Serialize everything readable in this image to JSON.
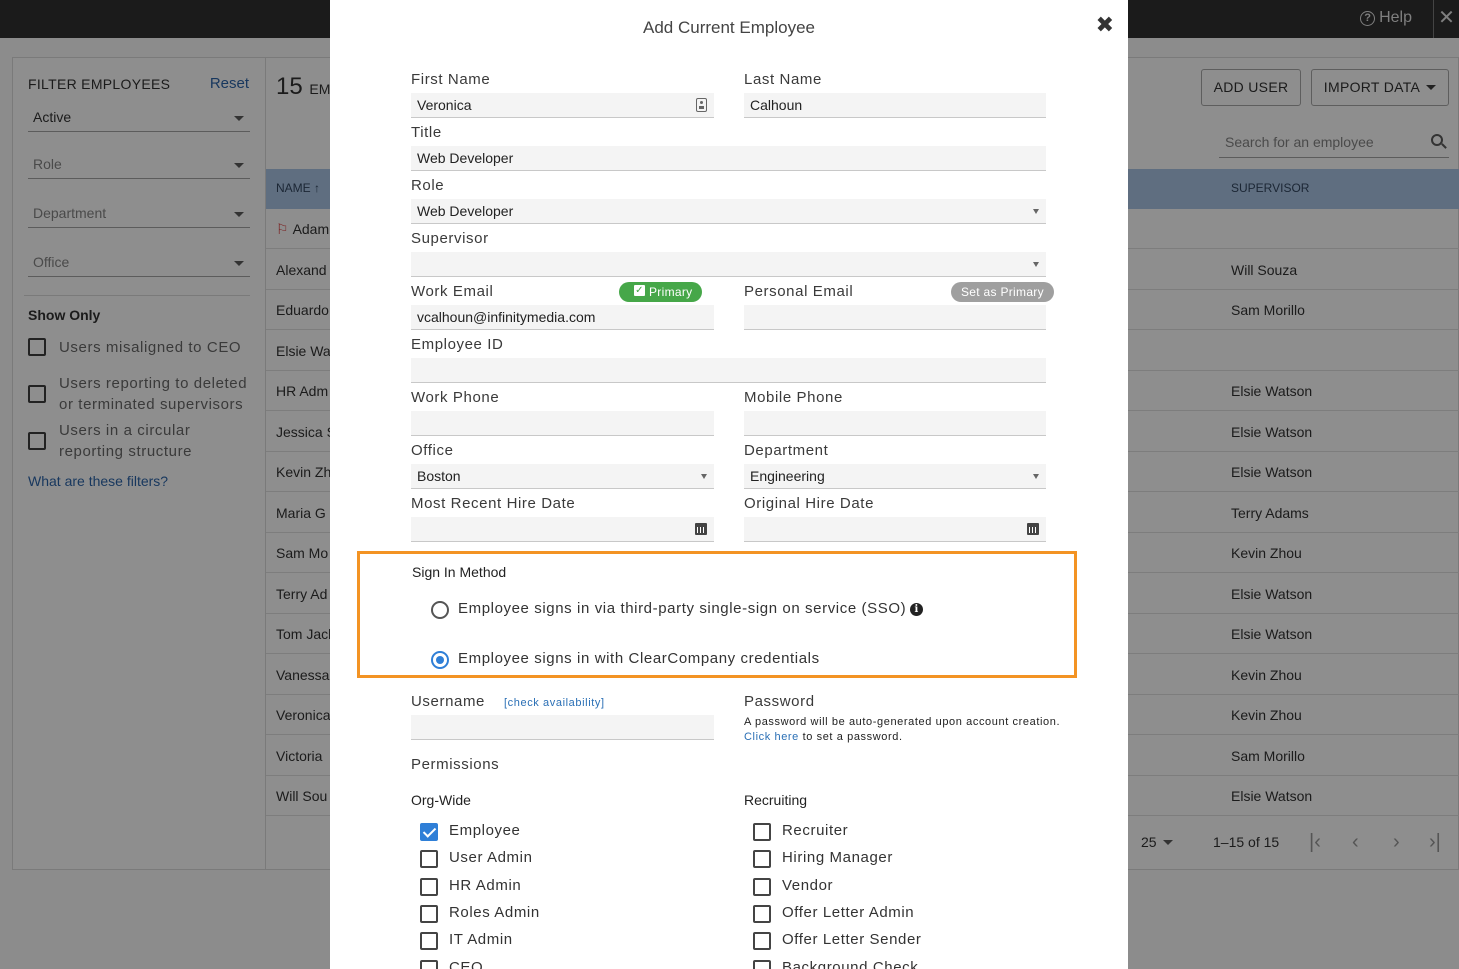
{
  "topbar": {
    "help_label": "Help",
    "close_glyph": "✕"
  },
  "filters": {
    "title": "FILTER EMPLOYEES",
    "reset": "Reset",
    "status": "Active",
    "role_placeholder": "Role",
    "department_placeholder": "Department",
    "office_placeholder": "Office",
    "show_only": "Show Only",
    "checks": [
      "Users misaligned to CEO",
      "Users reporting to deleted or terminated supervisors",
      "Users in a circular reporting structure"
    ],
    "help_link": "What are these filters?"
  },
  "list": {
    "count": "15",
    "count_suffix": "EMI",
    "add_user": "ADD USER",
    "import_data": "IMPORT DATA",
    "search_placeholder": "Search for an employee",
    "col_name": "NAME",
    "col_supervisor": "SUPERVISOR",
    "rows": [
      {
        "name": "Adam",
        "supervisor": ""
      },
      {
        "name": "Alexand",
        "supervisor": "Will Souza"
      },
      {
        "name": "Eduardo",
        "supervisor": "Sam Morillo"
      },
      {
        "name": "Elsie Wa",
        "supervisor": ""
      },
      {
        "name": "HR Adm",
        "supervisor": "Elsie Watson"
      },
      {
        "name": "Jessica S",
        "supervisor": "Elsie Watson"
      },
      {
        "name": "Kevin Zh",
        "supervisor": "Elsie Watson"
      },
      {
        "name": "Maria G",
        "supervisor": "Terry Adams"
      },
      {
        "name": "Sam Mo",
        "supervisor": "Kevin Zhou"
      },
      {
        "name": "Terry Ad",
        "supervisor": "Elsie Watson"
      },
      {
        "name": "Tom Jack",
        "supervisor": "Elsie Watson"
      },
      {
        "name": "Vanessa",
        "supervisor": "Kevin Zhou"
      },
      {
        "name": "Veronica",
        "supervisor": "Kevin Zhou"
      },
      {
        "name": "Victoria",
        "supervisor": "Sam Morillo"
      },
      {
        "name": "Will Sou",
        "supervisor": "Elsie Watson"
      }
    ],
    "per_page": "25",
    "range": "1–15 of 15"
  },
  "modal": {
    "title": "Add Current Employee",
    "close_glyph": "✖",
    "first_name_label": "First Name",
    "first_name": "Veronica",
    "last_name_label": "Last Name",
    "last_name": "Calhoun",
    "title_label": "Title",
    "title_value": "Web Developer",
    "role_label": "Role",
    "role_value": "Web Developer",
    "supervisor_label": "Supervisor",
    "supervisor_value": "",
    "work_email_label": "Work Email",
    "primary_badge": "Primary",
    "work_email": "vcalhoun@infinitymedia.com",
    "personal_email_label": "Personal Email",
    "set_primary_badge": "Set as Primary",
    "personal_email": "",
    "employee_id_label": "Employee ID",
    "employee_id": "",
    "work_phone_label": "Work Phone",
    "work_phone": "",
    "mobile_phone_label": "Mobile Phone",
    "mobile_phone": "",
    "office_label": "Office",
    "office_value": "Boston",
    "department_label": "Department",
    "department_value": "Engineering",
    "recent_hire_label": "Most Recent Hire Date",
    "recent_hire": "",
    "original_hire_label": "Original Hire Date",
    "original_hire": "",
    "sign_in": {
      "title": "Sign In Method",
      "sso": "Employee signs in via third-party single-sign on service (SSO)",
      "credentials": "Employee signs in with ClearCompany credentials",
      "selected": "credentials",
      "highlight_color": "#f39323"
    },
    "username_label": "Username",
    "check_availability": "[check availability]",
    "username": "",
    "password_label": "Password",
    "password_note": "A password will be auto-generated upon account creation.",
    "password_link": "Click here",
    "password_note_end": "to set a password.",
    "permissions_label": "Permissions",
    "org_wide_label": "Org-Wide",
    "recruiting_label": "Recruiting",
    "org_wide": [
      {
        "label": "Employee",
        "checked": true
      },
      {
        "label": "User Admin",
        "checked": false
      },
      {
        "label": "HR Admin",
        "checked": false
      },
      {
        "label": "Roles Admin",
        "checked": false
      },
      {
        "label": "IT Admin",
        "checked": false
      },
      {
        "label": "CEO",
        "checked": false
      }
    ],
    "recruiting": [
      {
        "label": "Recruiter",
        "checked": false
      },
      {
        "label": "Hiring Manager",
        "checked": false
      },
      {
        "label": "Vendor",
        "checked": false
      },
      {
        "label": "Offer Letter Admin",
        "checked": false
      },
      {
        "label": "Offer Letter Sender",
        "checked": false
      },
      {
        "label": "Background Check",
        "checked": false
      }
    ],
    "accent_color": "#2f7fd7",
    "primary_badge_color": "#46a749"
  }
}
